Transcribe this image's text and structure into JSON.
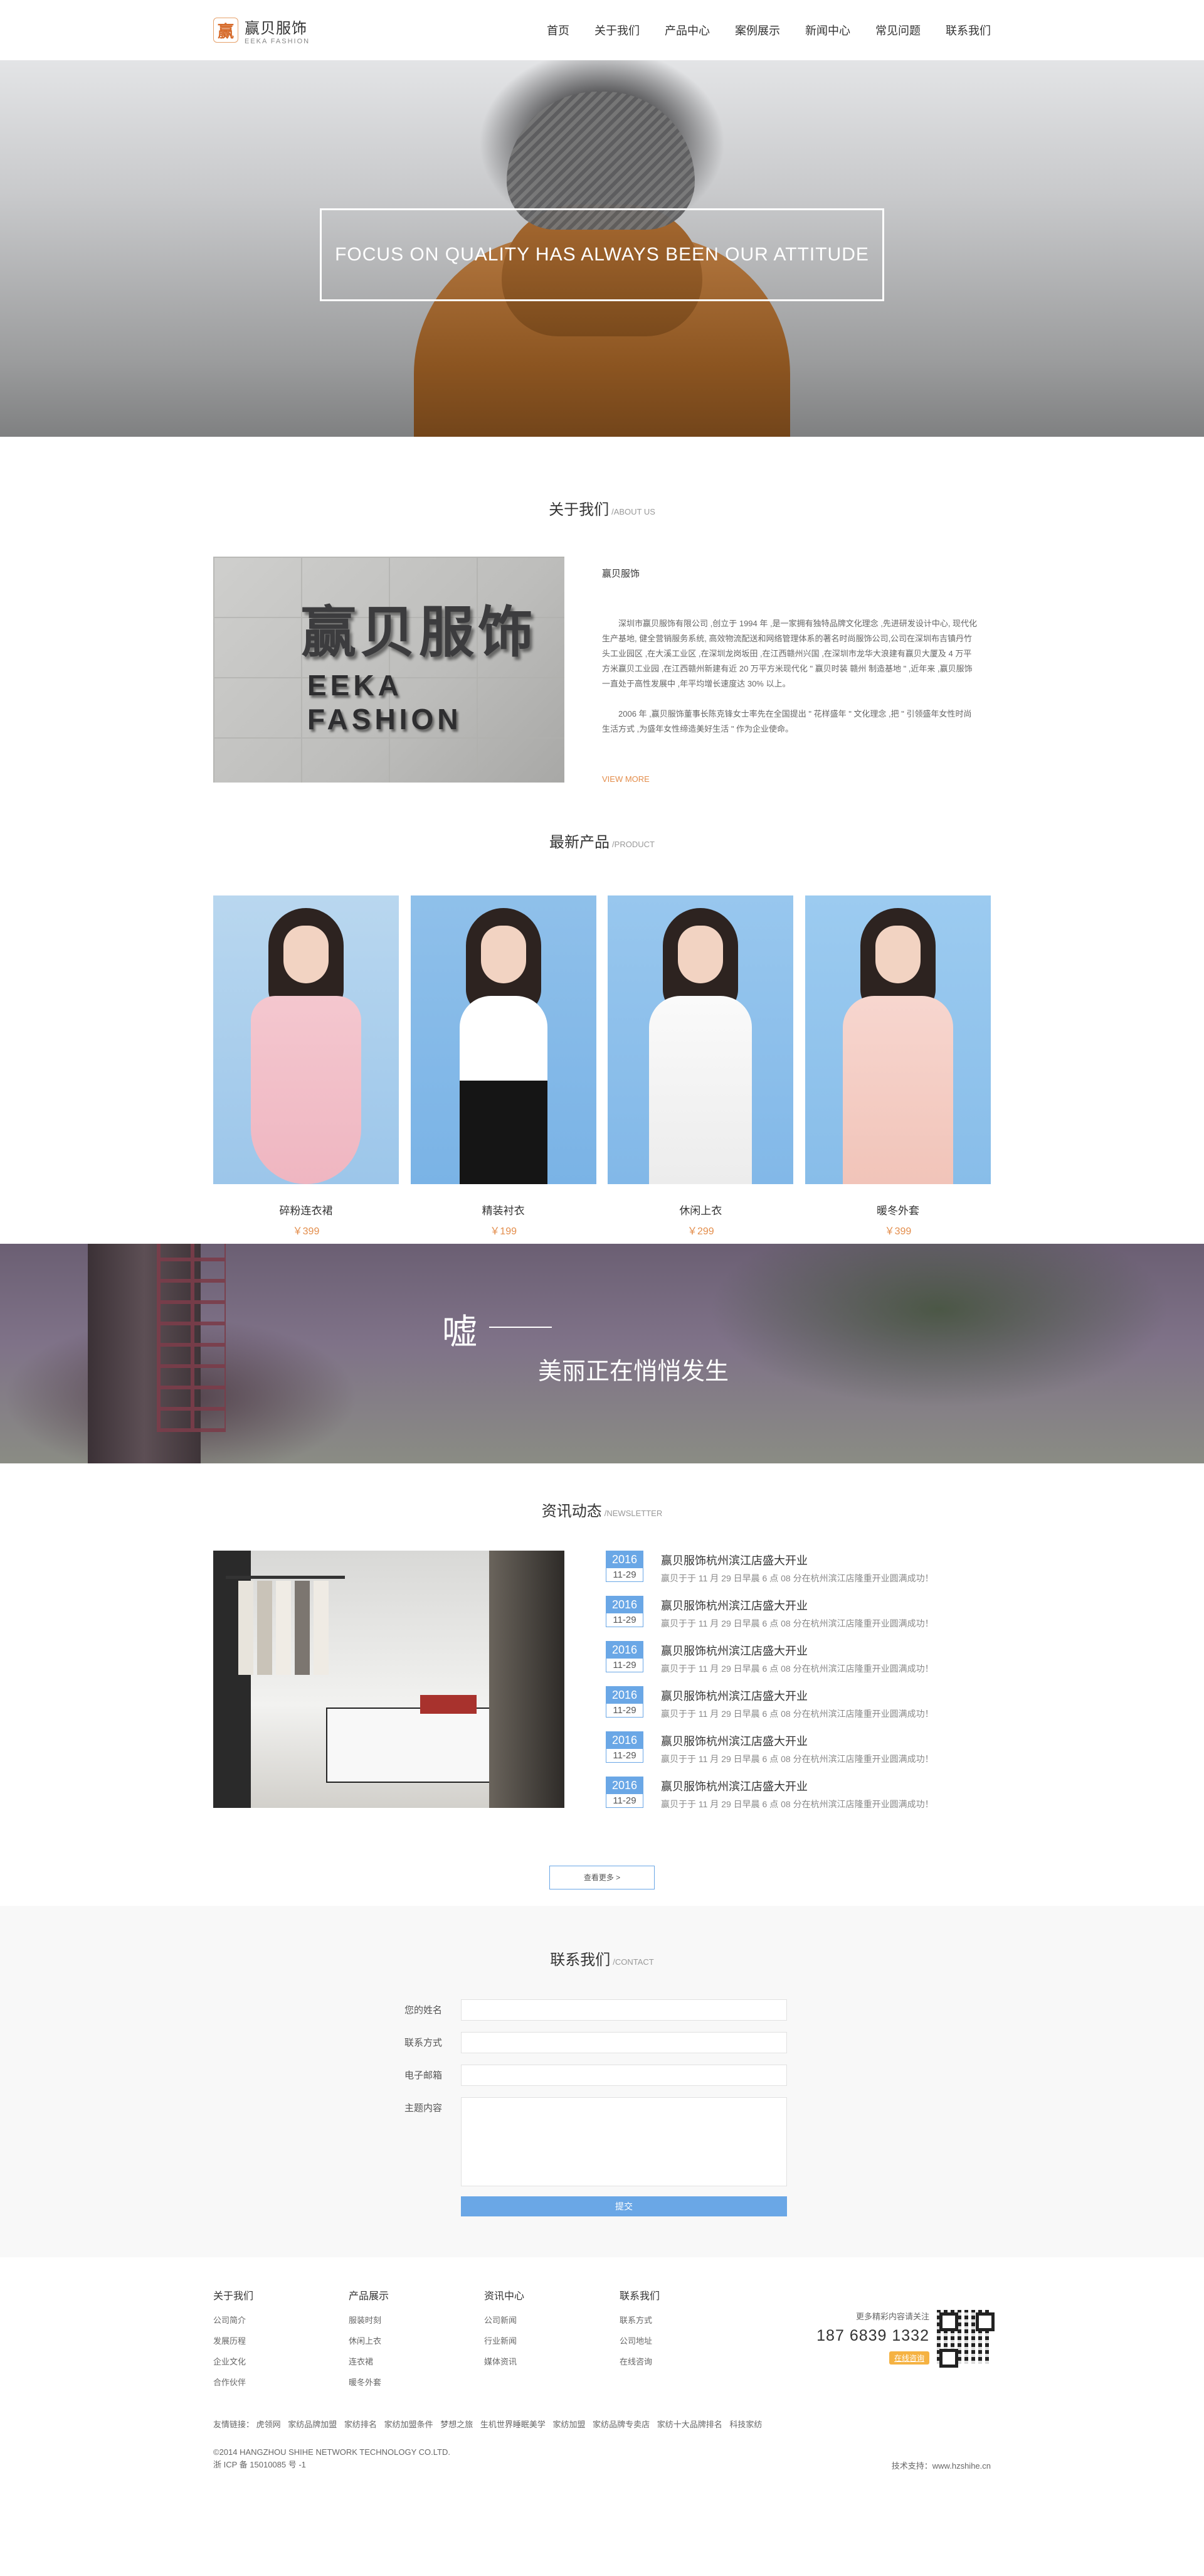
{
  "header": {
    "logo_mark": "赢",
    "logo_cn": "赢贝服饰",
    "logo_en": "EEKA FASHION",
    "nav": [
      "首页",
      "关于我们",
      "产品中心",
      "案例展示",
      "新闻中心",
      "常见问题",
      "联系我们"
    ]
  },
  "hero": {
    "slogan": "FOCUS ON QUALITY HAS ALWAYS BEEN OUR ATTITUDE"
  },
  "about": {
    "title_cn": "关于我们",
    "title_en": "/ABOUT US",
    "sign_cn": "赢贝服饰",
    "sign_en": "EEKA FASHION",
    "company": "赢贝服饰",
    "p1": "深圳市赢贝服饰有限公司 ,创立于 1994 年 ,是一家拥有独特品牌文化理念 ,先进研发设计中心, 现代化生产基地, 健全营销服务系统, 高效物流配送和网络管理体系的著名时尚服饰公司,公司在深圳布吉镇丹竹头工业园区 ,在大溪工业区 ,在深圳龙岗坂田 ,在江西赣州兴国 ,在深圳市龙华大浪建有赢贝大厦及 4 万平方米赢贝工业园 ,在江西赣州新建有近 20 万平方米现代化 \" 赢贝时装 赣州 制造基地 \" ,近年来 ,赢贝服饰一直处于高性发展中 ,年平均增长速度达 30% 以上。",
    "p2": "2006 年 ,赢贝服饰董事长陈克锋女士率先在全国提出 \" 花样盛年 \" 文化理念 ,把 \" 引领盛年女性时尚生活方式 ,为盛年女性缔造美好生活 \" 作为企业使命。",
    "more": "VIEW MORE"
  },
  "products": {
    "title_cn": "最新产品",
    "title_en": "/PRODUCT",
    "items": [
      {
        "name": "碎粉连衣裙",
        "price": "￥399"
      },
      {
        "name": "精装衬衣",
        "price": "￥199"
      },
      {
        "name": "休闲上衣",
        "price": "￥299"
      },
      {
        "name": "暖冬外套",
        "price": "￥399"
      }
    ]
  },
  "quote": {
    "big": "嘘",
    "sub": "美丽正在悄悄发生"
  },
  "news": {
    "title_cn": "资讯动态",
    "title_en": "/NEWSLETTER",
    "items": [
      {
        "year": "2016",
        "md": "11-29",
        "title": "赢贝服饰杭州滨江店盛大开业",
        "desc": "赢贝于于 11 月 29 日早晨 6 点 08 分在杭州滨江店隆重开业圆满成功！"
      },
      {
        "year": "2016",
        "md": "11-29",
        "title": "赢贝服饰杭州滨江店盛大开业",
        "desc": "赢贝于于 11 月 29 日早晨 6 点 08 分在杭州滨江店隆重开业圆满成功！"
      },
      {
        "year": "2016",
        "md": "11-29",
        "title": "赢贝服饰杭州滨江店盛大开业",
        "desc": "赢贝于于 11 月 29 日早晨 6 点 08 分在杭州滨江店隆重开业圆满成功！"
      },
      {
        "year": "2016",
        "md": "11-29",
        "title": "赢贝服饰杭州滨江店盛大开业",
        "desc": "赢贝于于 11 月 29 日早晨 6 点 08 分在杭州滨江店隆重开业圆满成功！"
      },
      {
        "year": "2016",
        "md": "11-29",
        "title": "赢贝服饰杭州滨江店盛大开业",
        "desc": "赢贝于于 11 月 29 日早晨 6 点 08 分在杭州滨江店隆重开业圆满成功！"
      },
      {
        "year": "2016",
        "md": "11-29",
        "title": "赢贝服饰杭州滨江店盛大开业",
        "desc": "赢贝于于 11 月 29 日早晨 6 点 08 分在杭州滨江店隆重开业圆满成功！"
      }
    ],
    "more": "查看更多 >"
  },
  "contact": {
    "title_cn": "联系我们",
    "title_en": "/CONTACT",
    "name_label": "您的姓名",
    "phone_label": "联系方式",
    "email_label": "电子邮箱",
    "content_label": "主题内容",
    "submit": "提交"
  },
  "footer": {
    "cols": [
      {
        "title": "关于我们",
        "links": [
          "公司简介",
          "发展历程",
          "企业文化",
          "合作伙伴"
        ]
      },
      {
        "title": "产品展示",
        "links": [
          "服装时刻",
          "休闲上衣",
          "连衣裙",
          "暖冬外套"
        ]
      },
      {
        "title": "资讯中心",
        "links": [
          "公司新闻",
          "行业新闻",
          "媒体资讯"
        ]
      },
      {
        "title": "联系我们",
        "links": [
          "联系方式",
          "公司地址",
          "在线咨询"
        ]
      }
    ],
    "hint": "更多精彩内容请关注",
    "phone": "187 6839 1332",
    "online": "在线咨询",
    "links_label": "友情链接：",
    "links": [
      "虎领网",
      "家纺品牌加盟",
      "家纺排名",
      "家纺加盟条件",
      "梦想之旅",
      "生机世界睡眠美学",
      "家纺加盟",
      "家纺品牌专卖店",
      "家纺十大品牌排名",
      "科技家纺"
    ],
    "copyright": "©2014 HANGZHOU SHIHE NETWORK TECHNOLOGY CO.LTD.",
    "icp": "浙 ICP 备 15010085 号 -1",
    "support": "技术支持：www.hzshihe.cn"
  },
  "colors": {
    "accent_orange": "#e38d4b",
    "accent_blue": "#6aa7e6",
    "price_orange": "#e38d4b"
  },
  "icons": {
    "logo": "logo-mark-icon",
    "qr": "qr-code-icon"
  }
}
